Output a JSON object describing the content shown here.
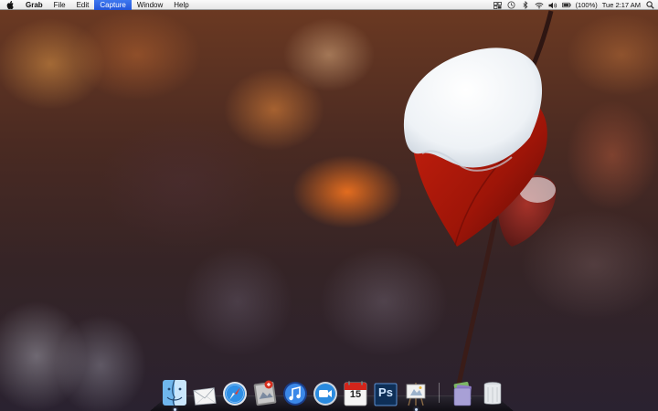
{
  "menubar": {
    "apple_icon": "apple-logo-icon",
    "items": [
      {
        "label": "Grab",
        "bold": true
      },
      {
        "label": "File"
      },
      {
        "label": "Edit"
      },
      {
        "label": "Capture",
        "active": true
      },
      {
        "label": "Window"
      },
      {
        "label": "Help"
      }
    ],
    "status": {
      "icons": [
        "spaces-icon",
        "time-machine-icon",
        "bluetooth-icon",
        "wifi-icon",
        "volume-icon",
        "battery-icon"
      ],
      "battery_percent": "(100%)",
      "clock": "Tue 2:17 AM",
      "spotlight_icon": "spotlight-search-icon"
    },
    "highlight_color": "#2f66e6"
  },
  "dock": {
    "items": [
      {
        "name": "finder",
        "icon": "finder-icon",
        "running": true
      },
      {
        "name": "mail",
        "icon": "mail-icon"
      },
      {
        "name": "safari",
        "icon": "safari-compass-icon"
      },
      {
        "name": "preview",
        "icon": "preview-icon"
      },
      {
        "name": "itunes",
        "icon": "itunes-icon"
      },
      {
        "name": "facetime",
        "icon": "facetime-camera-icon"
      },
      {
        "name": "ical",
        "icon": "calendar-icon",
        "label": "15"
      },
      {
        "name": "photoshop",
        "icon": "photoshop-icon",
        "label": "Ps"
      },
      {
        "name": "grab",
        "icon": "grab-easel-icon",
        "running": true
      }
    ],
    "stacks": [
      {
        "name": "stack",
        "icon": "stack-folder-icon"
      },
      {
        "name": "trash",
        "icon": "trash-icon"
      }
    ]
  }
}
